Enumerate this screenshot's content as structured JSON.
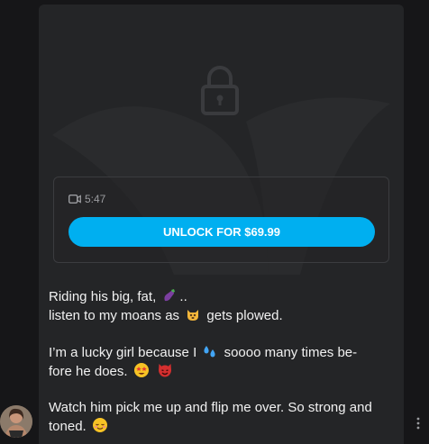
{
  "post": {
    "video_duration": "5:47",
    "unlock_label": "UNLOCK FOR $69.99",
    "lines": {
      "l1": "Riding his big, fat,",
      "l1_end": "..",
      "l2a": "listen to my moans as",
      "l2b": "gets plowed.",
      "l3a": "I’m a lucky girl because I",
      "l3b": "soooo many times be-",
      "l4": "fore he does.",
      "l5": "Watch him pick me up and flip me over. So strong and",
      "l6": "toned."
    }
  },
  "icons": {
    "lock": "lock-icon",
    "video": "video-camera-icon",
    "more": "more-vertical-icon",
    "emojis": [
      "eggplant-emoji",
      "cat-emoji",
      "sweat-droplets-emoji",
      "star-struck-emoji",
      "smiling-devil-emoji",
      "relieved-face-emoji"
    ]
  },
  "colors": {
    "accent": "#00aff0",
    "card_bg": "#242527",
    "page_bg": "#161618",
    "text": "#f1f1f1"
  }
}
